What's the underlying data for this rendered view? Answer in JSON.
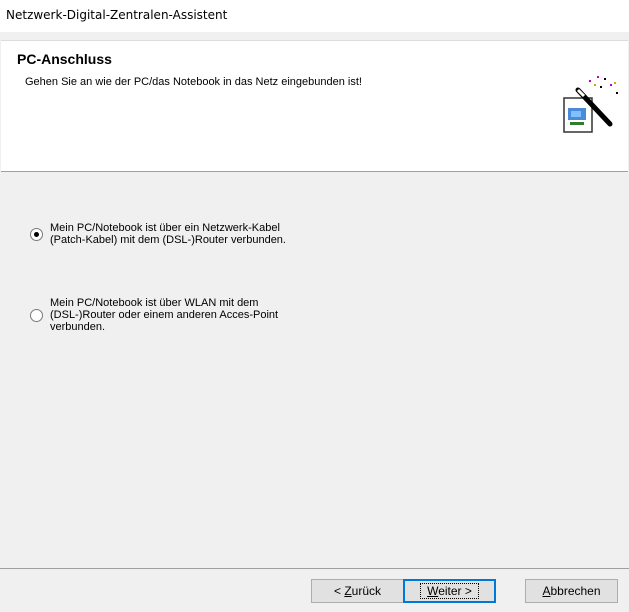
{
  "window": {
    "title": "Netzwerk-Digital-Zentralen-Assistent"
  },
  "header": {
    "heading": "PC-Anschluss",
    "subtitle": "Gehen Sie an wie der PC/das Notebook in das Netz eingebunden ist!",
    "icon": "wizard-wand-icon"
  },
  "options": [
    {
      "checked": true,
      "lines": [
        "Mein PC/Notebook ist über ein Netzwerk-Kabel",
        "(Patch-Kabel) mit dem (DSL-)Router verbunden."
      ]
    },
    {
      "checked": false,
      "lines": [
        "Mein PC/Notebook ist über WLAN mit dem",
        "(DSL-)Router oder einem anderen Acces-Point",
        "verbunden."
      ]
    }
  ],
  "buttons": {
    "back": {
      "prefix": "< ",
      "accel": "Z",
      "rest": "urück"
    },
    "next": {
      "accel": "W",
      "rest": "eiter >"
    },
    "cancel": {
      "accel": "A",
      "rest": "bbrechen"
    }
  }
}
